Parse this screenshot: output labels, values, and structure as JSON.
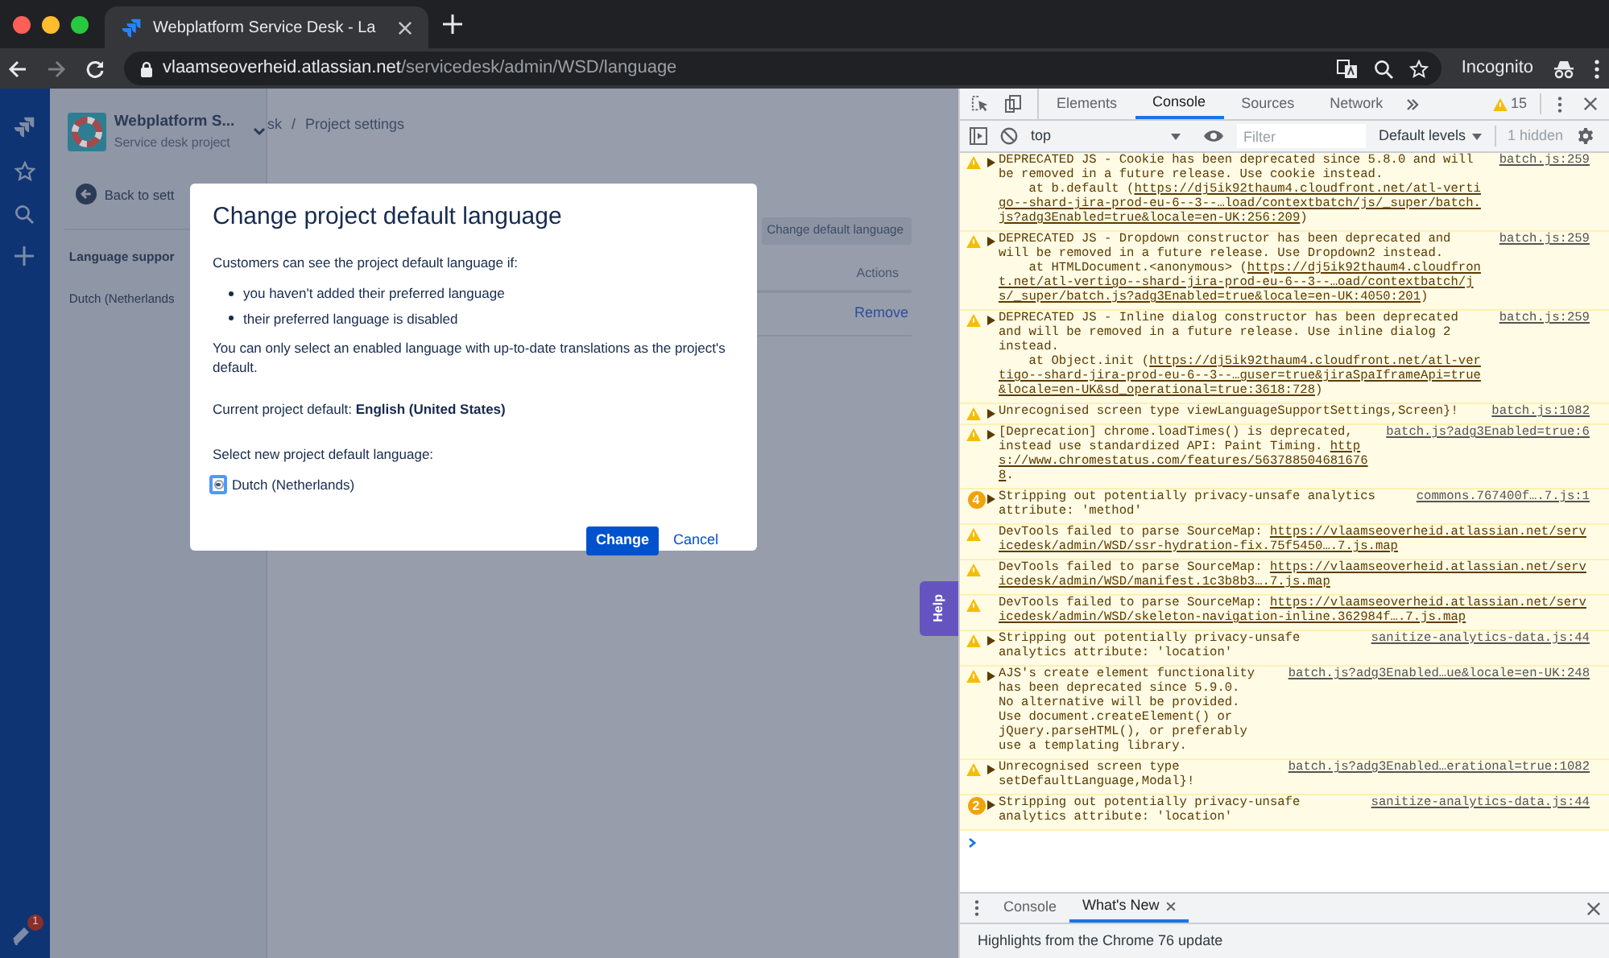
{
  "browser": {
    "tab": {
      "title": "Webplatform Service Desk - La"
    },
    "address": {
      "host": "vlaamseoverheid.atlassian.net",
      "path": "/servicedesk/admin/WSD/language"
    },
    "profile": "Incognito"
  },
  "jira_nav": {
    "notification_count": "1"
  },
  "project": {
    "name": "Webplatform S...",
    "type": "Service desk project"
  },
  "sidebar": {
    "back": "Back to sett",
    "section_title": "Language suppor",
    "items": [
      "Dutch (Netherlands"
    ]
  },
  "breadcrumb": {
    "items": [
      "sk",
      "Project settings"
    ],
    "separator": "/"
  },
  "main": {
    "action_button": "Change default language",
    "table": {
      "columns": [
        "Actions"
      ],
      "rows": [
        {
          "action": "Remove"
        }
      ]
    }
  },
  "help_tab": "Help",
  "dialog": {
    "title": "Change project default language",
    "intro": "Customers can see the project default language if:",
    "bullets": [
      "you haven't added their preferred language",
      "their preferred language is disabled"
    ],
    "note": "You can only select an enabled language with up-to-date translations as the project's default.",
    "current": "Current project default: **English (United States)**",
    "select_label": "Select new project default language:",
    "options": [
      {
        "label": "Dutch (Netherlands)",
        "selected": true
      }
    ],
    "buttons": [
      {
        "label": "Change",
        "kind": "primary"
      },
      {
        "label": "Cancel",
        "kind": "link"
      }
    ]
  },
  "devtools": {
    "tabs": [
      {
        "label": "Elements",
        "selected": false
      },
      {
        "label": "Console",
        "selected": true
      },
      {
        "label": "Sources",
        "selected": false
      },
      {
        "label": "Network",
        "selected": false
      }
    ],
    "warning_count": "15",
    "context": "top",
    "filter_placeholder": "Filter",
    "levels": "Default levels",
    "hidden": "1 hidden",
    "messages": [
      {
        "expandable": true,
        "source": "batch.js:259",
        "segments": [
          {
            "kind": "plain",
            "text": "DEPRECATED JS - Cookie has been deprecated since 5.8.0 and will be removed in a future release. Use cookie instead.\n    at b.default ("
          },
          {
            "kind": "link",
            "text": "https://dj5ik92thaum4.cloudfront.net/atl-vertigo--shard-jira-prod-eu-6--3--…load/contextbatch/js/_super/batch.js?adg3Enabled=true&locale=en-UK:256:209"
          },
          {
            "kind": "plain",
            "text": ")"
          }
        ]
      },
      {
        "expandable": true,
        "source": "batch.js:259",
        "segments": [
          {
            "kind": "plain",
            "text": "DEPRECATED JS - Dropdown constructor has been deprecated and will be removed in a future release. Use Dropdown2 instead.\n    at HTMLDocument.<anonymous> ("
          },
          {
            "kind": "link",
            "text": "https://dj5ik92thaum4.cloudfront.net/atl-vertigo--shard-jira-prod-eu-6--3--…oad/contextbatch/js/_super/batch.js?adg3Enabled=true&locale=en-UK:4050:201"
          },
          {
            "kind": "plain",
            "text": ")"
          }
        ]
      },
      {
        "expandable": true,
        "source": "batch.js:259",
        "segments": [
          {
            "kind": "plain",
            "text": "DEPRECATED JS - Inline dialog constructor has been deprecated and will be removed in a future release. Use inline dialog 2 instead.\n    at Object.init ("
          },
          {
            "kind": "link",
            "text": "https://dj5ik92thaum4.cloudfront.net/atl-vertigo--shard-jira-prod-eu-6--3--…guser=true&jiraSpaIframeApi=true&locale=en-UK&sd_operational=true:3618:728"
          },
          {
            "kind": "plain",
            "text": ")"
          }
        ]
      },
      {
        "expandable": true,
        "source": "batch.js:1082",
        "segments": [
          {
            "kind": "plain",
            "text": "Unrecognised screen type viewLanguageSupportSettings,Screen}!"
          }
        ]
      },
      {
        "expandable": true,
        "source": "batch.js?adg3Enabled=true:6",
        "segments": [
          {
            "kind": "plain",
            "text": "[Deprecation] chrome.loadTimes() is deprecated, instead use standardized API: Paint Timing. "
          },
          {
            "kind": "link",
            "text": "https://www.chromestatus.com/features/5637885046816768"
          },
          {
            "kind": "plain",
            "text": "."
          }
        ]
      },
      {
        "expandable": true,
        "count": "4",
        "source": "commons.767400f….7.js:1",
        "segments": [
          {
            "kind": "plain",
            "text": "Stripping out potentially privacy-unsafe analytics attribute: 'method'"
          }
        ]
      },
      {
        "expandable": false,
        "segments": [
          {
            "kind": "plain",
            "text": "DevTools failed to parse SourceMap: "
          },
          {
            "kind": "link",
            "text": "https://vlaamseoverheid.atlassian.net/servicedesk/admin/WSD/ssr-hydration-fix.75f5450….7.js.map"
          }
        ]
      },
      {
        "expandable": false,
        "segments": [
          {
            "kind": "plain",
            "text": "DevTools failed to parse SourceMap: "
          },
          {
            "kind": "link",
            "text": "https://vlaamseoverheid.atlassian.net/servicedesk/admin/WSD/manifest.1c3b8b3….7.js.map"
          }
        ]
      },
      {
        "expandable": false,
        "segments": [
          {
            "kind": "plain",
            "text": "DevTools failed to parse SourceMap: "
          },
          {
            "kind": "link",
            "text": "https://vlaamseoverheid.atlassian.net/servicedesk/admin/WSD/skeleton-navigation-inline.362984f….7.js.map"
          }
        ]
      },
      {
        "expandable": true,
        "source": "sanitize-analytics-data.js:44",
        "segments": [
          {
            "kind": "plain",
            "text": "Stripping out potentially privacy-unsafe analytics attribute: 'location'"
          }
        ]
      },
      {
        "expandable": true,
        "source": "batch.js?adg3Enabled…ue&locale=en-UK:248",
        "segments": [
          {
            "kind": "plain",
            "text": "AJS's create element functionality has been deprecated since 5.9.0.\nNo alternative will be provided.\nUse document.createElement() or jQuery.parseHTML(), or preferably use a templating library."
          }
        ]
      },
      {
        "expandable": true,
        "source": "batch.js?adg3Enabled…erational=true:1082",
        "segments": [
          {
            "kind": "plain",
            "text": "Unrecognised screen type setDefaultLanguage,Modal}!"
          }
        ]
      },
      {
        "expandable": true,
        "count": "2",
        "source": "sanitize-analytics-data.js:44",
        "segments": [
          {
            "kind": "plain",
            "text": "Stripping out potentially privacy-unsafe analytics attribute: 'location'"
          }
        ]
      }
    ],
    "drawer": {
      "tabs": [
        {
          "label": "Console",
          "selected": false,
          "closable": false
        },
        {
          "label": "What's New",
          "selected": true,
          "closable": true
        }
      ],
      "content": "Highlights from the Chrome 76 update"
    }
  }
}
